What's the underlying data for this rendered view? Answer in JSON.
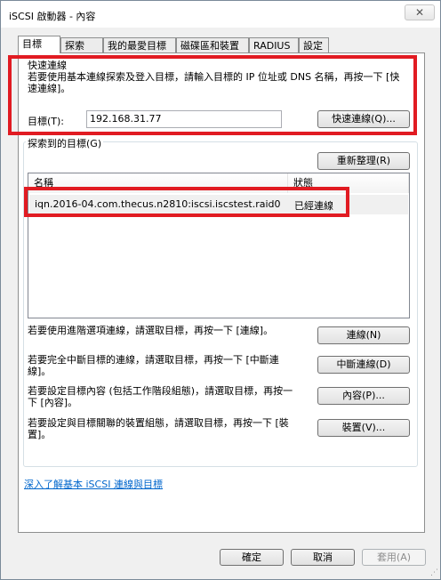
{
  "window": {
    "title": "iSCSI 啟動器 - 內容",
    "close_glyph": "✕"
  },
  "tabs": [
    {
      "label": "目標"
    },
    {
      "label": "探索"
    },
    {
      "label": "我的最愛目標"
    },
    {
      "label": "磁碟區和裝置"
    },
    {
      "label": "RADIUS"
    },
    {
      "label": "設定"
    }
  ],
  "quick_connect": {
    "heading": "快速連線",
    "description": "若要使用基本連線探索及登入目標，請輸入目標的 IP 位址或 DNS 名稱，再按一下 [快速連線]。",
    "target_label": "目標(T):",
    "target_value": "192.168.31.77",
    "button_label": "快速連線(Q)..."
  },
  "discovered": {
    "legend": "探索到的目標(G)",
    "refresh_label": "重新整理(R)",
    "columns": [
      "名稱",
      "狀態"
    ],
    "rows": [
      {
        "name": "iqn.2016-04.com.thecus.n2810:iscsi.iscstest.raid0",
        "status": "已經連線"
      }
    ]
  },
  "actions": [
    {
      "text": "若要使用進階選項連線，請選取目標，再按一下 [連線]。",
      "button": "連線(N)"
    },
    {
      "text": "若要完全中斷目標的連線，請選取目標，再按一下 [中斷連線]。",
      "button": "中斷連線(D)"
    },
    {
      "text": "若要設定目標內容 (包括工作階段組態)，請選取目標，再按一下 [內容]。",
      "button": "內容(P)..."
    },
    {
      "text": "若要設定與目標關聯的裝置組態，請選取目標，再按一下 [裝置]。",
      "button": "裝置(V)..."
    }
  ],
  "help_link": "深入了解基本 iSCSI 連線與目標",
  "footer": {
    "ok": "確定",
    "cancel": "取消",
    "apply": "套用(A)"
  },
  "colors": {
    "highlight": "#e11b22",
    "link": "#0066cc"
  }
}
